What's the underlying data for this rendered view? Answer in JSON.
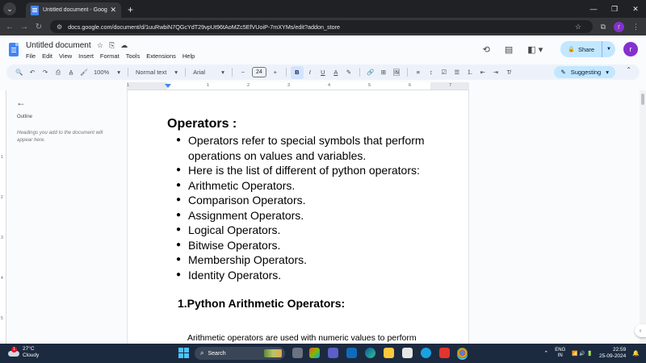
{
  "browser": {
    "tab_menu_glyph": "⌄",
    "tab_title": "Untitled document - Google Do",
    "tab_close_glyph": "✕",
    "new_tab_glyph": "+",
    "window_controls": [
      "—",
      "❐",
      "✕"
    ],
    "nav": {
      "back": "←",
      "forward": "→",
      "reload": "↻"
    },
    "url": "docs.google.com/document/d/1uuRwbiN7QGcYdT29vpUt96tAoMZc5EfVUoiP-7mXYMs/edit?addon_store",
    "star_glyph": "☆",
    "extensions_glyph": "⧉",
    "profile_initial": "r",
    "menu_glyph": "⋮"
  },
  "docs": {
    "title": "Untitled document",
    "title_icons": [
      "☆",
      "⎘",
      "☁"
    ],
    "menu": [
      "File",
      "Edit",
      "View",
      "Insert",
      "Format",
      "Tools",
      "Extensions",
      "Help"
    ],
    "header_icons": {
      "history": "⟲",
      "comments": "▤",
      "meet": "◧ ▾"
    },
    "share_label": "Share",
    "share_lock": "🔒",
    "share_dropdown": "▼",
    "user_initial": "r"
  },
  "toolbar": {
    "search": "🔍",
    "undo": "↶",
    "redo": "↷",
    "print": "⎙",
    "spellcheck": "A̲",
    "paint": "🖌",
    "zoom": "100%",
    "style": "Normal text",
    "font": "Arial",
    "minus": "−",
    "font_size": "24",
    "plus": "+",
    "bold": "B",
    "italic": "I",
    "underline": "U",
    "text_color": "A",
    "highlight": "✎",
    "link": "🔗",
    "comment": "⊞",
    "image": "🖼",
    "align": "≡",
    "line_spacing": "↕",
    "checklist": "☑",
    "bullets": "☰",
    "numbered": "⒈",
    "indent_less": "⇤",
    "indent_more": "⇥",
    "clear_format": "T̸",
    "dropdown": "▾",
    "mode_icon": "✎",
    "mode_label": "Suggesting",
    "collapse": "⌃"
  },
  "ruler": {
    "numbers": [
      "1",
      "1",
      "2",
      "3",
      "4",
      "5",
      "6",
      "7"
    ]
  },
  "vruler": {
    "numbers": [
      "1",
      "2",
      "3",
      "4",
      "5"
    ]
  },
  "outline": {
    "back_glyph": "←",
    "title": "Outline",
    "hint": "Headings you add to the document will appear here."
  },
  "document": {
    "heading": "Operators :",
    "bullets": [
      "Operators refer to special symbols that perform operations on values and variables.",
      "Here is the list of different of python operators:",
      "Arithmetic Operators.",
      "Comparison Operators.",
      "Assignment Operators.",
      "Logical Operators.",
      "Bitwise Operators.",
      "Membership Operators.",
      "Identity Operators."
    ],
    "section_heading": "1.Python Arithmetic Operators:",
    "paragraph": "Arithmetic operators are used with numeric values to perform"
  },
  "side_toggle_glyph": "‹",
  "taskbar": {
    "weather_badge": "1",
    "temperature": "27°C",
    "condition": "Cloudy",
    "search_glyph": "⌕",
    "search_label": "Search",
    "tray_up": "⌃",
    "lang_line1": "ENG",
    "lang_line2": "IN",
    "tray_icons": "📶 🔊 🔋",
    "time": "22:59",
    "date": "25-09-2024",
    "notifications": "🔔"
  },
  "colors": {
    "accent": "#c2e7ff",
    "docs_blue": "#4285f4",
    "profile": "#8430ce",
    "taskbar": "#1c2a40"
  }
}
